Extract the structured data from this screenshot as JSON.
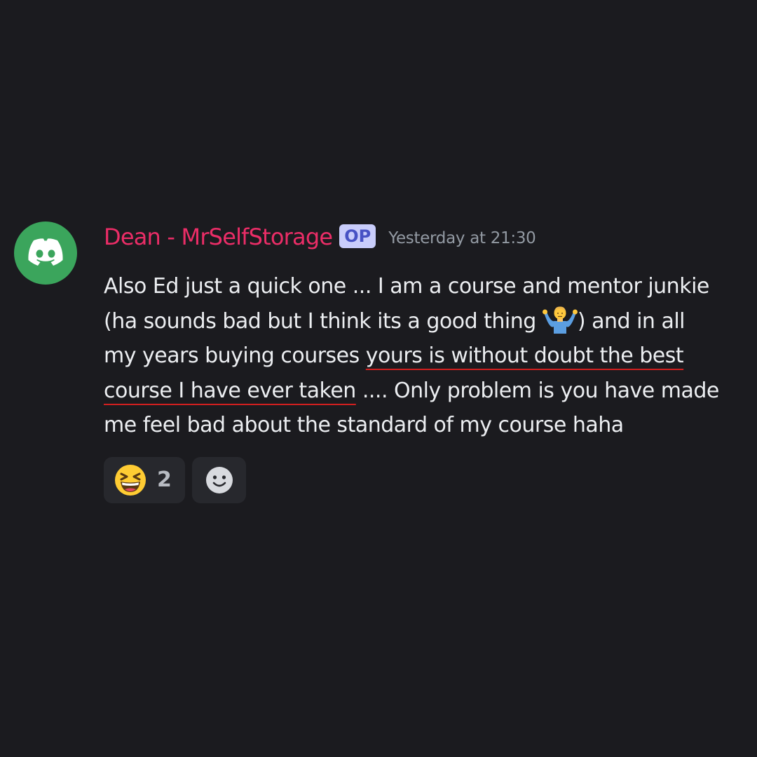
{
  "message": {
    "avatar_icon": "discord-logo-icon",
    "avatar_color": "#3ba55c",
    "username": "Dean - MrSelfStorage",
    "username_color": "#eb2d67",
    "badge": "OP",
    "timestamp": "Yesterday at 21:30",
    "lines": [
      {
        "text": "Also Ed just a quick one ... I am a course and mentor junkie"
      },
      {
        "pre": "(ha sounds bad but I think its a good thing ",
        "emoji": "person-shrugging-emoji",
        "post": ") and in all"
      },
      {
        "pre": "my years buying courses ",
        "underlined": "yours is without doubt the best"
      },
      {
        "underlined": "course I have ever taken",
        "post": " .... Only problem is you have made"
      },
      {
        "text": "me feel bad about the standard of my course haha"
      }
    ],
    "underline_color": "#d21f1f"
  },
  "reactions": [
    {
      "emoji": "grinning-squinting-face-emoji",
      "count": "2"
    },
    {
      "emoji": "add-reaction-icon"
    }
  ]
}
